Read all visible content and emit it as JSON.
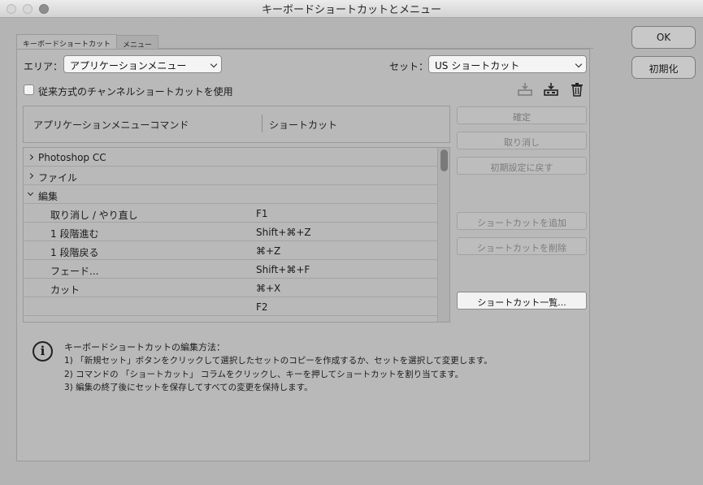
{
  "window": {
    "title": "キーボードショートカットとメニュー"
  },
  "tabs": [
    {
      "label": "キーボードショートカット"
    },
    {
      "label": "メニュー"
    }
  ],
  "area": {
    "label": "エリア：",
    "value": "アプリケーションメニュー"
  },
  "set": {
    "label": "セット：",
    "value": "US ショートカット"
  },
  "legacy_checkbox": {
    "label": "従来方式のチャンネルショートカットを使用",
    "checked": false
  },
  "table": {
    "headers": {
      "command": "アプリケーションメニューコマンド",
      "shortcut": "ショートカット"
    },
    "rows": [
      {
        "command": "Photoshop CC",
        "shortcut": "",
        "expander": "collapsed"
      },
      {
        "command": "ファイル",
        "shortcut": "",
        "expander": "collapsed"
      },
      {
        "command": "編集",
        "shortcut": "",
        "expander": "expanded"
      },
      {
        "command": "取り消し / やり直し",
        "shortcut": "F1",
        "expander": "none"
      },
      {
        "command": "1 段階進む",
        "shortcut": "Shift+⌘+Z",
        "expander": "none"
      },
      {
        "command": "1 段階戻る",
        "shortcut": "⌘+Z",
        "expander": "none"
      },
      {
        "command": "フェード...",
        "shortcut": "Shift+⌘+F",
        "expander": "none"
      },
      {
        "command": "カット",
        "shortcut": "⌘+X",
        "expander": "none"
      },
      {
        "command": "",
        "shortcut": "F2",
        "expander": "none"
      }
    ]
  },
  "side_buttons": {
    "accept": "確定",
    "undo": "取り消し",
    "reset_default": "初期設定に戻す",
    "add_shortcut": "ショートカットを追加",
    "delete_shortcut": "ショートカットを削除",
    "summarize": "ショートカット一覧..."
  },
  "dialog_buttons": {
    "ok": "OK",
    "reset": "初期化"
  },
  "info": {
    "heading": "キーボードショートカットの編集方法：",
    "lines": [
      "1) 「新規セット」ボタンをクリックして選択したセットのコピーを作成するか、セットを選択して変更します。",
      "2) コマンドの 「ショートカット」 コラムをクリックし、キーを押してショートカットを割り当てます。",
      "3) 編集の終了後にセットを保存してすべての変更を保持します。"
    ]
  },
  "icons": [
    "save-set-icon",
    "new-set-icon",
    "delete-set-icon",
    "info-icon"
  ]
}
